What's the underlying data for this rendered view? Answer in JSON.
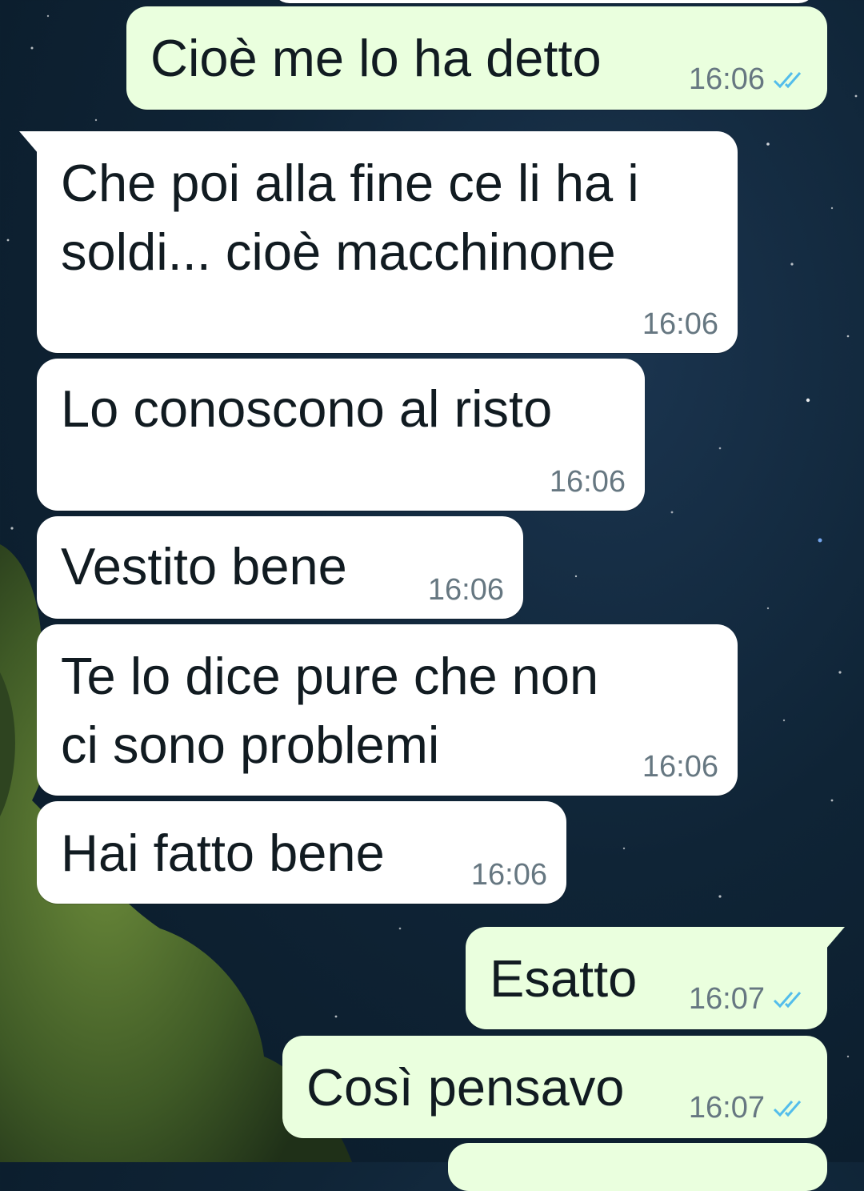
{
  "chat": {
    "accent_color": "#53bdeb",
    "background_theme": "night sky with trees",
    "messages": [
      {
        "id": "m1",
        "direction": "outgoing",
        "text": "Cioè me lo ha detto",
        "time": "16:06",
        "status": "read",
        "status_icon": "double-check-icon"
      },
      {
        "id": "m2",
        "direction": "incoming",
        "text": "Che poi alla fine ce li ha i\nsoldi... cioè macchinone",
        "time": "16:06"
      },
      {
        "id": "m3",
        "direction": "incoming",
        "text": "Lo conoscono al risto",
        "time": "16:06"
      },
      {
        "id": "m4",
        "direction": "incoming",
        "text": "Vestito bene",
        "time": "16:06"
      },
      {
        "id": "m5",
        "direction": "incoming",
        "text": "Te lo dice pure che non\nci sono problemi",
        "time": "16:06"
      },
      {
        "id": "m6",
        "direction": "incoming",
        "text": "Hai fatto bene",
        "time": "16:06"
      },
      {
        "id": "m7",
        "direction": "outgoing",
        "text": "Esatto",
        "time": "16:07",
        "status": "read",
        "status_icon": "double-check-icon"
      },
      {
        "id": "m8",
        "direction": "outgoing",
        "text": "Così pensavo",
        "time": "16:07",
        "status": "read",
        "status_icon": "double-check-icon"
      }
    ]
  }
}
